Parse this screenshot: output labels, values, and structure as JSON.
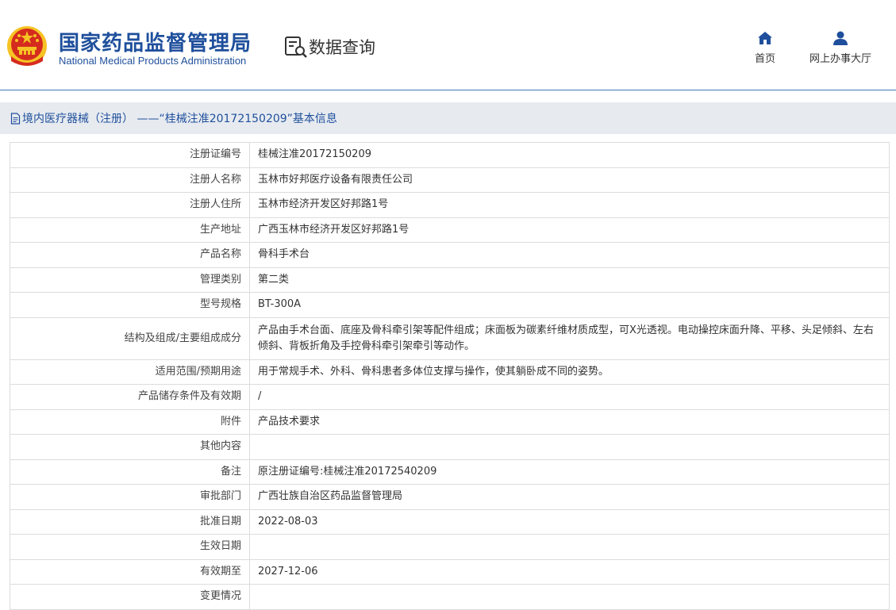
{
  "header": {
    "org_name_cn": "国家药品监督管理局",
    "org_name_en": "National Medical Products Administration",
    "query_label": "数据查询",
    "nav": [
      {
        "label": "首页",
        "icon": "home-icon"
      },
      {
        "label": "网上办事大厅",
        "icon": "user-icon"
      }
    ]
  },
  "title_bar": {
    "icon": "document-icon",
    "text": "境内医疗器械（注册） ——“桂械注准20172150209”基本信息"
  },
  "colors": {
    "brand_blue": "#1f4f9c",
    "header_rule": "#3f79b9",
    "titlebar_bg": "#e7ebf0",
    "emblem_red": "#d52b1e",
    "emblem_gold": "#f6c324"
  },
  "rows": [
    {
      "label": "注册证编号",
      "value": "桂械注准20172150209"
    },
    {
      "label": "注册人名称",
      "value": "玉林市好邦医疗设备有限责任公司"
    },
    {
      "label": "注册人住所",
      "value": "玉林市经济开发区好邦路1号"
    },
    {
      "label": "生产地址",
      "value": "广西玉林市经济开发区好邦路1号"
    },
    {
      "label": "产品名称",
      "value": "骨科手术台"
    },
    {
      "label": "管理类别",
      "value": "第二类"
    },
    {
      "label": "型号规格",
      "value": "BT-300A"
    },
    {
      "label": "结构及组成/主要组成成分",
      "value": "产品由手术台面、底座及骨科牵引架等配件组成；床面板为碳素纤维材质成型，可X光透视。电动操控床面升降、平移、头足倾斜、左右倾斜、背板折角及手控骨科牵引架牵引等动作。"
    },
    {
      "label": "适用范围/预期用途",
      "value": "用于常规手术、外科、骨科患者多体位支撑与操作，使其躺卧成不同的姿势。"
    },
    {
      "label": "产品储存条件及有效期",
      "value": "/"
    },
    {
      "label": "附件",
      "value": "产品技术要求"
    },
    {
      "label": "其他内容",
      "value": ""
    },
    {
      "label": "备注",
      "value": "原注册证编号:桂械注准20172540209"
    },
    {
      "label": "审批部门",
      "value": "广西壮族自治区药品监督管理局"
    },
    {
      "label": "批准日期",
      "value": "2022-08-03"
    },
    {
      "label": "生效日期",
      "value": ""
    },
    {
      "label": "有效期至",
      "value": "2027-12-06"
    },
    {
      "label": "变更情况",
      "value": ""
    }
  ]
}
